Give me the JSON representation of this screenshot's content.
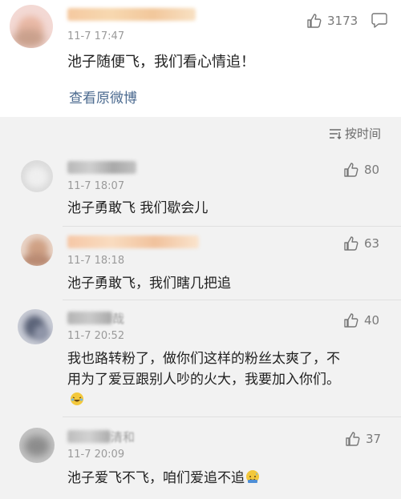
{
  "main_post": {
    "time": "11-7 17:47",
    "text": "池子随便飞，我们看心情追！",
    "view_original": "查看原微博",
    "likes": "3173"
  },
  "sort": {
    "label": "按时间",
    "icon": "sort-lines-icon"
  },
  "comments": [
    {
      "time": "11-7 18:07",
      "text": "池子勇敢飞 我们歇会儿",
      "likes": "80"
    },
    {
      "time": "11-7 18:18",
      "text": "池子勇敢飞，我们瞎几把追",
      "likes": "63"
    },
    {
      "name_tail": "哉",
      "time": "11-7 20:52",
      "text_line1": "我也路转粉了，做你们这样的粉丝太爽了，不",
      "text_line2": "用为了爱豆跟别人吵的火大，我要加入你们。",
      "likes": "40",
      "emoji": "laughing-emoji-icon"
    },
    {
      "name_tail": "清和",
      "time": "11-7 20:09",
      "text": "池子爱飞不飞，咱们爱追不追",
      "likes": "37",
      "emoji": "sweat-smile-emoji-icon"
    }
  ],
  "colors": {
    "link": "#4b6a8f",
    "text": "#222222",
    "meta": "#9a9a9a",
    "background": "#f2f2f2"
  }
}
